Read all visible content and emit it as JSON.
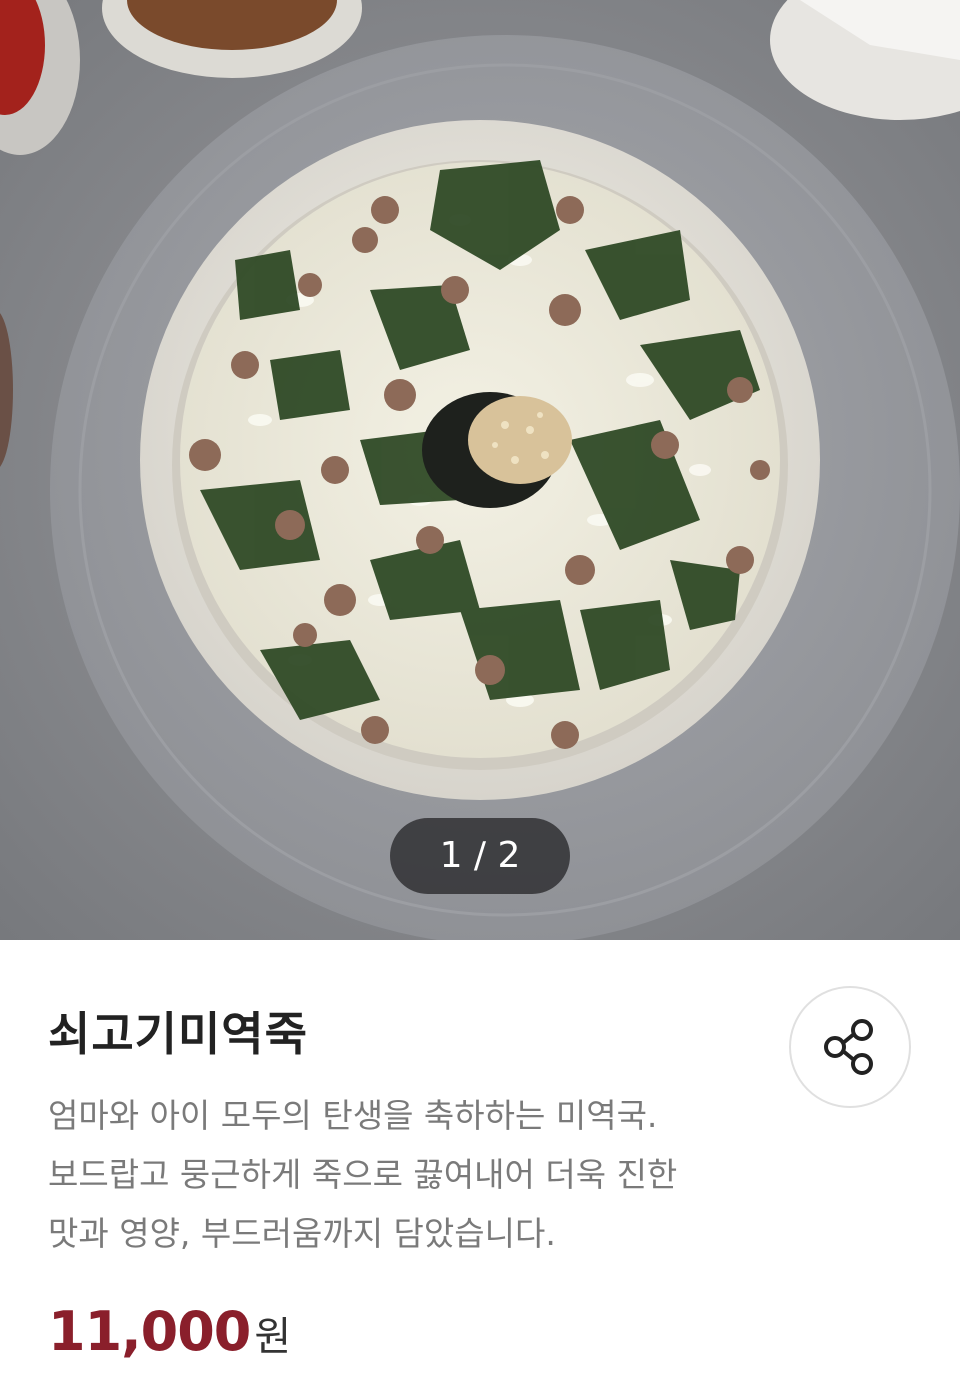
{
  "gallery": {
    "counter_text": "1 / 2",
    "image_alt": "쇠고기미역죽 상품 이미지"
  },
  "product": {
    "name": "쇠고기미역죽",
    "description": "엄마와 아이 모두의 탄생을 축하하는 미역국.\n보드랍고 뭉근하게 죽으로 끓여내어 더욱 진한\n맛과 영양, 부드러움까지 담았습니다.",
    "price": "11,000",
    "currency": "원"
  },
  "icons": {
    "share": "share-icon"
  },
  "colors": {
    "price": "#8a1f2b",
    "title": "#222222",
    "description": "#7a7a7a"
  }
}
